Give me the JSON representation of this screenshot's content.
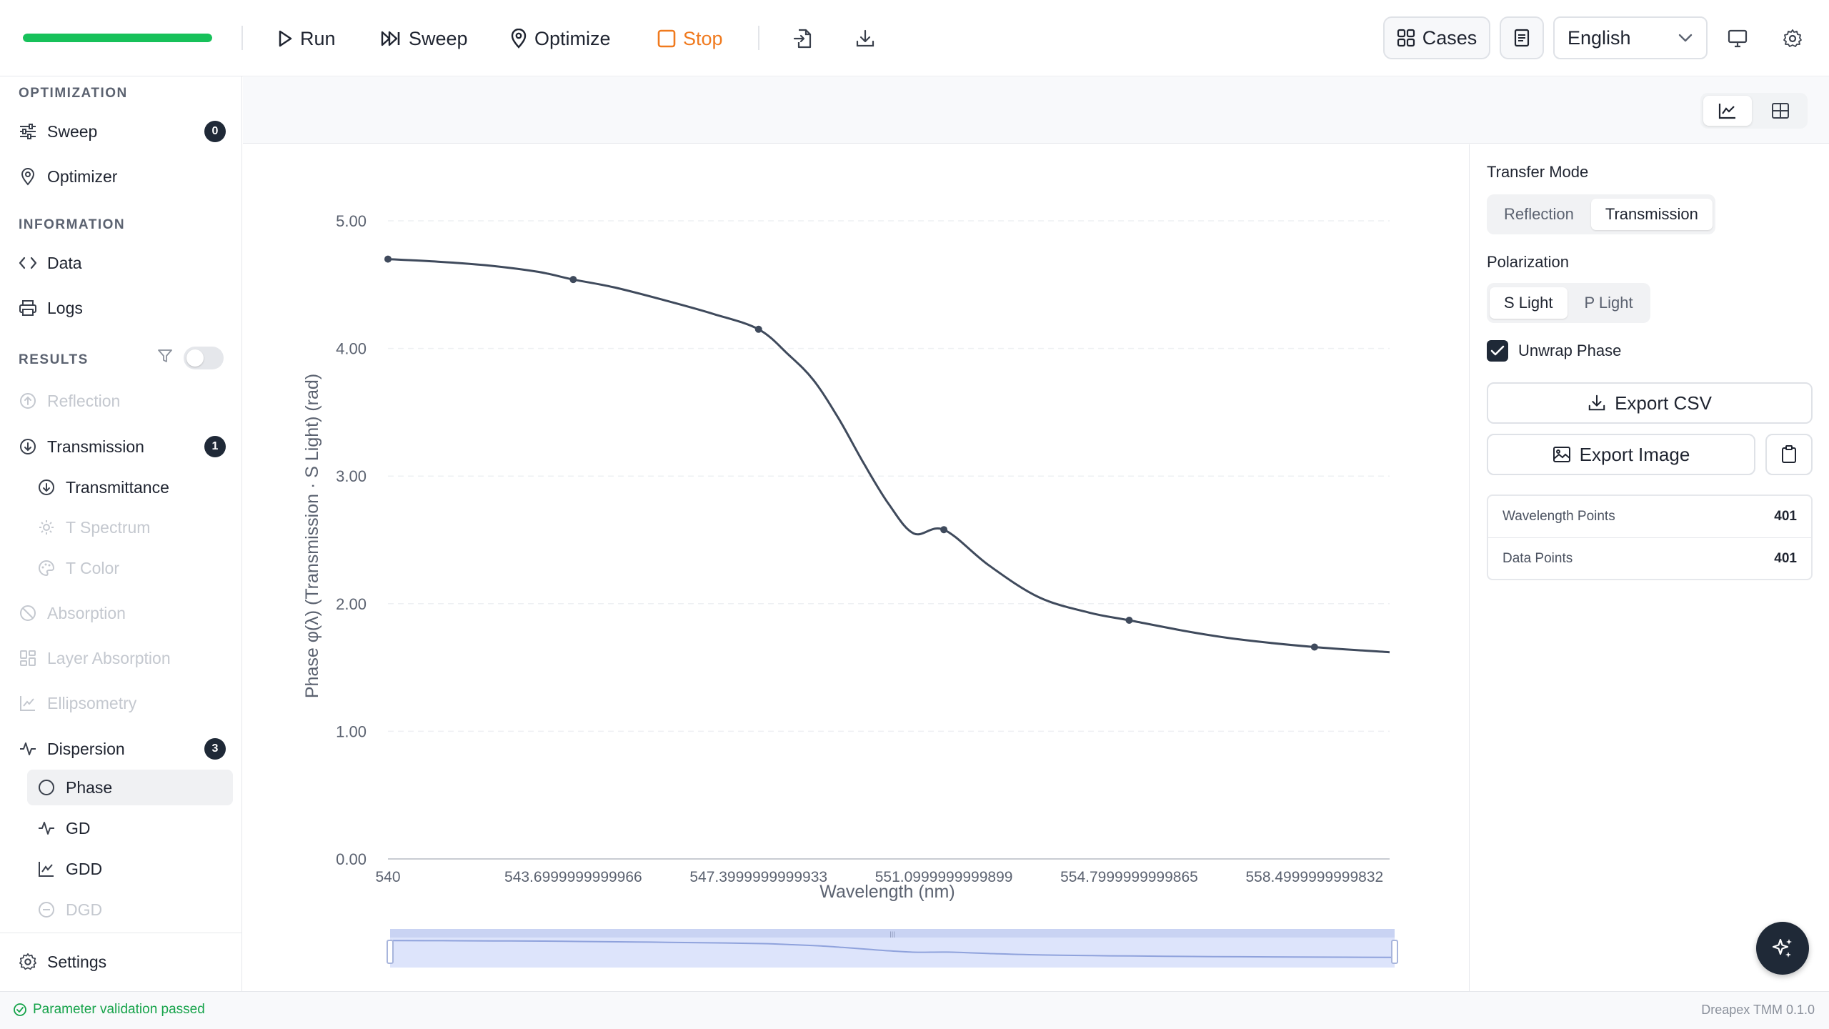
{
  "toolbar": {
    "progress_fraction": 1.0,
    "run_label": "Run",
    "sweep_label": "Sweep",
    "optimize_label": "Optimize",
    "stop_label": "Stop",
    "cases_label": "Cases",
    "language": "English"
  },
  "sidebar": {
    "optimization_title": "OPTIMIZATION",
    "sweep_label": "Sweep",
    "sweep_badge": "0",
    "optimizer_label": "Optimizer",
    "information_title": "INFORMATION",
    "data_label": "Data",
    "logs_label": "Logs",
    "results_title": "RESULTS",
    "reflection_label": "Reflection",
    "transmission_label": "Transmission",
    "transmission_badge": "1",
    "transmittance_label": "Transmittance",
    "t_spectrum_label": "T Spectrum",
    "t_color_label": "T Color",
    "absorption_label": "Absorption",
    "layer_absorption_label": "Layer Absorption",
    "ellipsometry_label": "Ellipsometry",
    "dispersion_label": "Dispersion",
    "dispersion_badge": "3",
    "phase_label": "Phase",
    "gd_label": "GD",
    "gdd_label": "GDD",
    "dgd_label": "DGD",
    "settings_label": "Settings"
  },
  "panel": {
    "transfer_mode_label": "Transfer Mode",
    "reflection_option": "Reflection",
    "transmission_option": "Transmission",
    "polarization_label": "Polarization",
    "s_light_option": "S Light",
    "p_light_option": "P Light",
    "unwrap_label": "Unwrap Phase",
    "unwrap_checked": true,
    "export_csv_label": "Export CSV",
    "export_image_label": "Export Image",
    "wavelength_points_label": "Wavelength Points",
    "wavelength_points_value": "401",
    "data_points_label": "Data Points",
    "data_points_value": "401"
  },
  "status": {
    "message": "Parameter validation passed",
    "version": "Dreapex TMM 0.1.0"
  },
  "colors": {
    "progress": "#17c15a",
    "stop": "#f07a1e",
    "line": "#3f4a5c",
    "status_ok": "#16a34a",
    "slider": "#d7def8"
  },
  "chart_data": {
    "type": "line",
    "xlabel": "Wavelength (nm)",
    "ylabel": "Phase φ(λ) (Transmission · S Light) (rad)",
    "xlim": [
      540,
      560
    ],
    "ylim": [
      0,
      5
    ],
    "yticks": [
      "0.00",
      "1.00",
      "2.00",
      "3.00",
      "4.00",
      "5.00"
    ],
    "xticks": [
      {
        "value": 540,
        "label": "540"
      },
      {
        "value": 543.7,
        "label": "543.6999999999966"
      },
      {
        "value": 547.4,
        "label": "547.3999999999933"
      },
      {
        "value": 551.1,
        "label": "551.0999999999899"
      },
      {
        "value": 554.8,
        "label": "554.7999999999865"
      },
      {
        "value": 558.5,
        "label": "558.4999999999832"
      }
    ],
    "grid": true,
    "series": [
      {
        "x": [
          540,
          541,
          542,
          543,
          543.7,
          544.5,
          545.5,
          546.5,
          547.4,
          548,
          548.5,
          549,
          549.5,
          550,
          550.5,
          551.1,
          552,
          553,
          554,
          554.8,
          556,
          557,
          558.5,
          560
        ],
        "y": [
          4.7,
          4.68,
          4.65,
          4.6,
          4.54,
          4.48,
          4.38,
          4.27,
          4.15,
          3.95,
          3.75,
          3.45,
          3.1,
          2.78,
          2.55,
          2.58,
          2.3,
          2.05,
          1.93,
          1.87,
          1.78,
          1.72,
          1.66,
          1.62
        ]
      }
    ],
    "markers": [
      {
        "x": 540,
        "y": 4.7
      },
      {
        "x": 543.7,
        "y": 4.54
      },
      {
        "x": 547.4,
        "y": 4.15
      },
      {
        "x": 551.1,
        "y": 2.58
      },
      {
        "x": 554.8,
        "y": 1.87
      },
      {
        "x": 558.5,
        "y": 1.66
      }
    ]
  }
}
